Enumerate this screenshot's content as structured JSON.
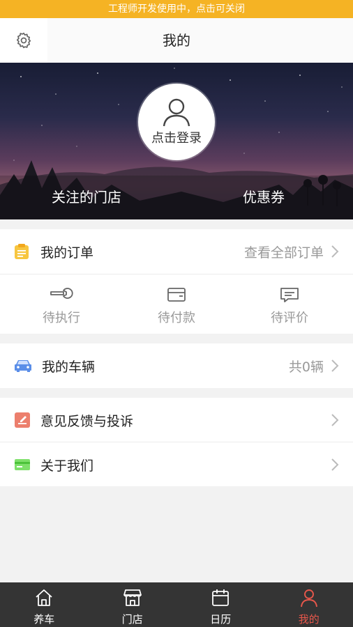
{
  "dev_banner": {
    "text": "工程师开发使用中，点击可关闭"
  },
  "nav": {
    "title": "我的",
    "settings_icon": "gear-icon"
  },
  "hero": {
    "login_label": "点击登录",
    "followed_stores_label": "关注的门店",
    "coupons_label": "优惠券"
  },
  "orders": {
    "title": "我的订单",
    "view_all_label": "查看全部订单",
    "statuses": [
      {
        "label": "待执行",
        "icon": "wrench-icon"
      },
      {
        "label": "待付款",
        "icon": "wallet-icon"
      },
      {
        "label": "待评价",
        "icon": "comment-icon"
      }
    ]
  },
  "vehicles": {
    "title": "我的车辆",
    "count_label": "共0辆"
  },
  "feedback": {
    "title": "意见反馈与投诉"
  },
  "about": {
    "title": "关于我们"
  },
  "tabbar": {
    "items": [
      {
        "label": "养车",
        "icon": "home-icon"
      },
      {
        "label": "门店",
        "icon": "store-icon"
      },
      {
        "label": "日历",
        "icon": "calendar-icon"
      },
      {
        "label": "我的",
        "icon": "user-icon",
        "active": true
      }
    ]
  },
  "colors": {
    "banner": "#f5b324",
    "active_tab": "#e7574b",
    "tabbar_bg": "#343434"
  }
}
